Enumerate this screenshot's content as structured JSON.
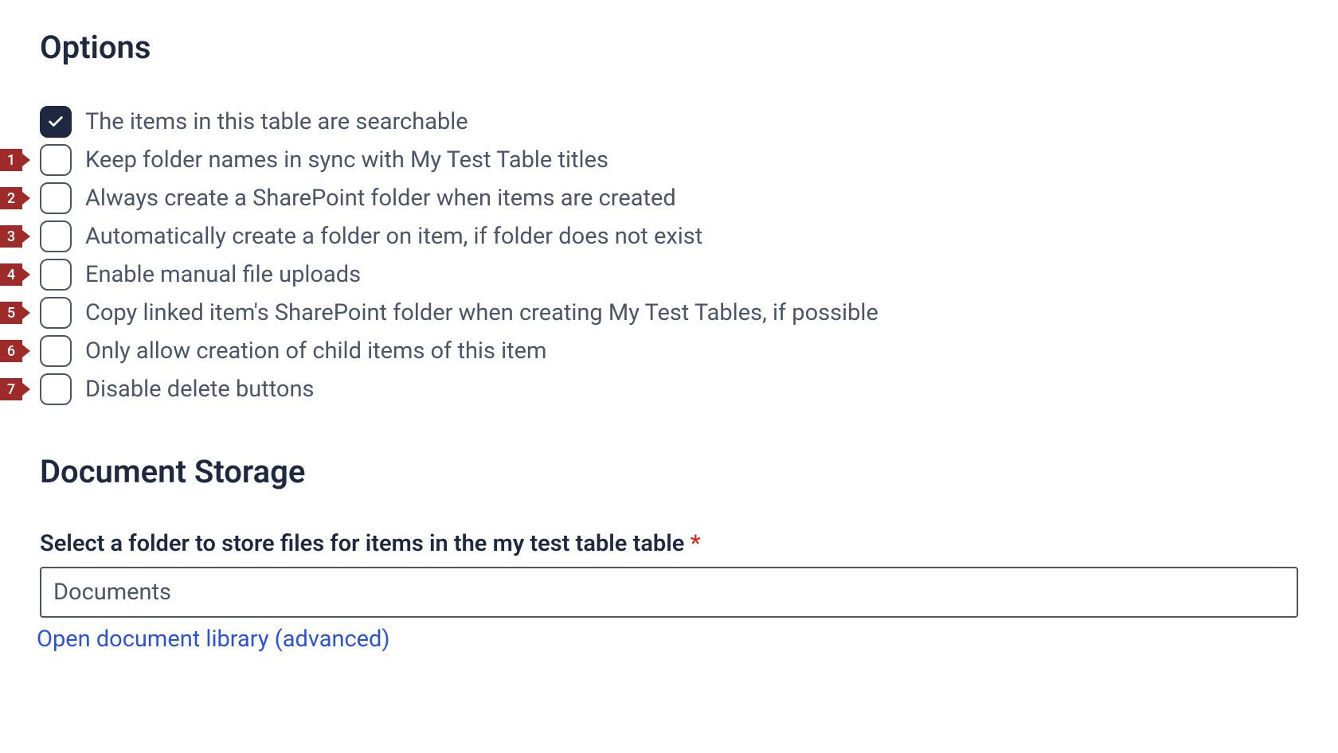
{
  "options": {
    "heading": "Options",
    "items": [
      {
        "label": "The items in this table are searchable",
        "checked": true,
        "marker": null
      },
      {
        "label": "Keep folder names in sync with My Test Table titles",
        "checked": false,
        "marker": "1"
      },
      {
        "label": "Always create a SharePoint folder when items are created",
        "checked": false,
        "marker": "2"
      },
      {
        "label": "Automatically create a folder on item, if folder does not exist",
        "checked": false,
        "marker": "3"
      },
      {
        "label": "Enable manual file uploads",
        "checked": false,
        "marker": "4"
      },
      {
        "label": "Copy linked item's SharePoint folder when creating My Test Tables, if possible",
        "checked": false,
        "marker": "5"
      },
      {
        "label": "Only allow creation of child items of this item",
        "checked": false,
        "marker": "6"
      },
      {
        "label": "Disable delete buttons",
        "checked": false,
        "marker": "7"
      }
    ]
  },
  "storage": {
    "heading": "Document Storage",
    "field_label": "Select a folder to store files for items in the my test table table",
    "required_mark": "*",
    "folder_value": "Documents",
    "advanced_link": "Open document library (advanced)"
  }
}
